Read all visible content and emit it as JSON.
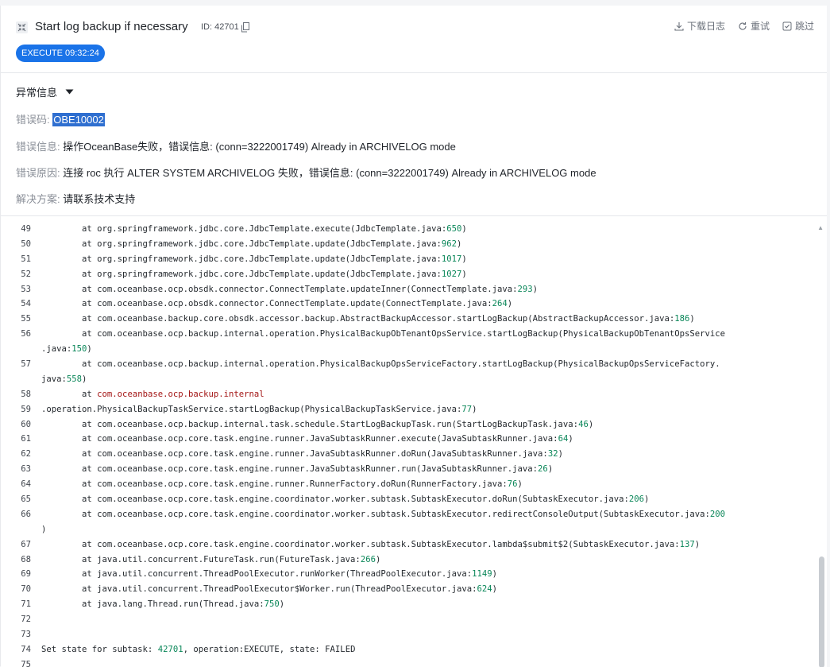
{
  "header": {
    "title": "Start log backup if necessary",
    "id_label": "ID: 42701",
    "actions": [
      {
        "label": "下载日志",
        "icon": "download-icon"
      },
      {
        "label": "重试",
        "icon": "retry-icon"
      },
      {
        "label": "跳过",
        "icon": "skip-icon"
      }
    ],
    "status_badge": "EXECUTE 09:32:24"
  },
  "error": {
    "section_title": "异常信息",
    "rows": [
      {
        "key": "错误码:",
        "value": "OBE10002"
      },
      {
        "key": "错误信息:",
        "value": "操作OceanBase失败，错误信息: (conn=3222001749) Already in ARCHIVELOG mode"
      },
      {
        "key": "错误原因:",
        "value": "连接 roc 执行 ALTER SYSTEM ARCHIVELOG 失败，错误信息: (conn=3222001749) Already in ARCHIVELOG mode"
      },
      {
        "key": "解决方案:",
        "value": "请联系技术支持"
      }
    ]
  },
  "log": {
    "lines": [
      {
        "n": "49",
        "text": "        at org.springframework.jdbc.core.JdbcTemplate.execute(JdbcTemplate.java:650)"
      },
      {
        "n": "50",
        "text": "        at org.springframework.jdbc.core.JdbcTemplate.update(JdbcTemplate.java:962)"
      },
      {
        "n": "51",
        "text": "        at org.springframework.jdbc.core.JdbcTemplate.update(JdbcTemplate.java:1017)"
      },
      {
        "n": "52",
        "text": "        at org.springframework.jdbc.core.JdbcTemplate.update(JdbcTemplate.java:1027)"
      },
      {
        "n": "53",
        "text": "        at com.oceanbase.ocp.obsdk.connector.ConnectTemplate.updateInner(ConnectTemplate.java:293)"
      },
      {
        "n": "54",
        "text": "        at com.oceanbase.ocp.obsdk.connector.ConnectTemplate.update(ConnectTemplate.java:264)"
      },
      {
        "n": "55",
        "text": "        at com.oceanbase.backup.core.obsdk.accessor.backup.AbstractBackupAccessor.startLogBackup(AbstractBackupAccessor.java:186)"
      },
      {
        "n": "56",
        "text": "        at com.oceanbase.ocp.backup.internal.operation.PhysicalBackupObTenantOpsService.startLogBackup(PhysicalBackupObTenantOpsService"
      },
      {
        "n": "",
        "text": ".java:150)"
      },
      {
        "n": "57",
        "text": "        at com.oceanbase.ocp.backup.internal.operation.PhysicalBackupOpsServiceFactory.startLogBackup(PhysicalBackupOpsServiceFactory."
      },
      {
        "n": "",
        "text": "java:558)"
      },
      {
        "n": "58",
        "text": "        at com.oceanbase.ocp.backup.internal",
        "pkg": true
      },
      {
        "n": "59",
        "text": ".operation.PhysicalBackupTaskService.startLogBackup(PhysicalBackupTaskService.java:77)"
      },
      {
        "n": "60",
        "text": "        at com.oceanbase.ocp.backup.internal.task.schedule.StartLogBackupTask.run(StartLogBackupTask.java:46)"
      },
      {
        "n": "61",
        "text": "        at com.oceanbase.ocp.core.task.engine.runner.JavaSubtaskRunner.execute(JavaSubtaskRunner.java:64)"
      },
      {
        "n": "62",
        "text": "        at com.oceanbase.ocp.core.task.engine.runner.JavaSubtaskRunner.doRun(JavaSubtaskRunner.java:32)"
      },
      {
        "n": "63",
        "text": "        at com.oceanbase.ocp.core.task.engine.runner.JavaSubtaskRunner.run(JavaSubtaskRunner.java:26)"
      },
      {
        "n": "64",
        "text": "        at com.oceanbase.ocp.core.task.engine.runner.RunnerFactory.doRun(RunnerFactory.java:76)"
      },
      {
        "n": "65",
        "text": "        at com.oceanbase.ocp.core.task.engine.coordinator.worker.subtask.SubtaskExecutor.doRun(SubtaskExecutor.java:206)"
      },
      {
        "n": "66",
        "text": "        at com.oceanbase.ocp.core.task.engine.coordinator.worker.subtask.SubtaskExecutor.redirectConsoleOutput(SubtaskExecutor.java:200"
      },
      {
        "n": "",
        "text": ")"
      },
      {
        "n": "67",
        "text": "        at com.oceanbase.ocp.core.task.engine.coordinator.worker.subtask.SubtaskExecutor.lambda$submit$2(SubtaskExecutor.java:137)"
      },
      {
        "n": "68",
        "text": "        at java.util.concurrent.FutureTask.run(FutureTask.java:266)"
      },
      {
        "n": "69",
        "text": "        at java.util.concurrent.ThreadPoolExecutor.runWorker(ThreadPoolExecutor.java:1149)"
      },
      {
        "n": "70",
        "text": "        at java.util.concurrent.ThreadPoolExecutor$Worker.run(ThreadPoolExecutor.java:624)"
      },
      {
        "n": "71",
        "text": "        at java.lang.Thread.run(Thread.java:750)"
      },
      {
        "n": "72",
        "text": ""
      },
      {
        "n": "73",
        "text": ""
      },
      {
        "n": "74",
        "text": "Set state for subtask: 42701, operation:EXECUTE, state: FAILED"
      },
      {
        "n": "75",
        "text": ""
      }
    ]
  },
  "colors": {
    "accent": "#1a73e8",
    "number": "#098658",
    "package": "#a31515",
    "highlight": "#2f6fd0"
  }
}
